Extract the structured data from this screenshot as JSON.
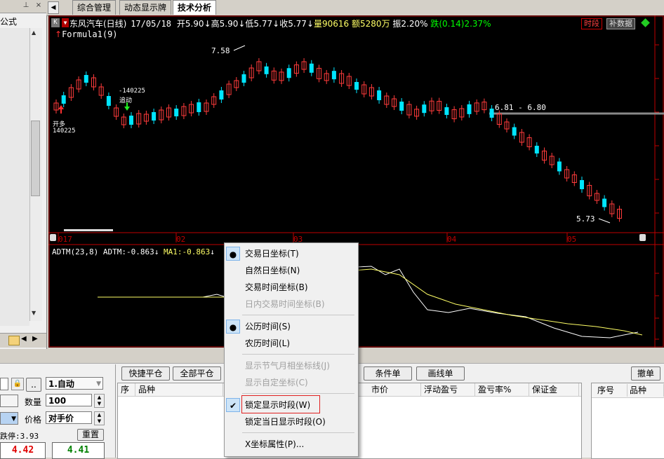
{
  "left_panel": {
    "title_label": "公式",
    "pin_glyph": "⊥",
    "close_glyph": "×"
  },
  "tabs": {
    "nav_arrow": "◀",
    "items": [
      {
        "label": "综合管理"
      },
      {
        "label": "动态显示牌"
      },
      {
        "label": "技术分析"
      }
    ]
  },
  "chart": {
    "header": {
      "k_badge": "K",
      "stock": "东风汽车(日线)",
      "date": "17/05/18",
      "open": "开5.90",
      "high": "高5.90",
      "low": "低5.77",
      "close": "收5.77",
      "volume": "量90616",
      "amount": "额5280万",
      "amplitude": "振2.20%",
      "change": "跌(0.14)2.37%",
      "formula": "Formula1(9)",
      "btn_period": "时段",
      "btn_fill": "补数据"
    },
    "annotations": {
      "high_label": "7.58",
      "low_label": "5.73",
      "range_line": "6.81 - 6.80",
      "buy_label": "开多",
      "buy_date": "140225",
      "chase_code": "-140225",
      "chase_label": "追动"
    },
    "x_axis": [
      "017",
      "02",
      "03",
      "04",
      "05"
    ],
    "indicator": {
      "name": "ADTM(23,8)",
      "adtm": "ADTM:-0.863",
      "ma1": "MA1:-0.863"
    },
    "colors": {
      "up": "#ff3b3b",
      "down": "#00e5ff",
      "axis": "#c00000",
      "ma": "#ffff66"
    }
  },
  "context_menu": {
    "items": [
      {
        "label": "交易日坐标(T)",
        "mark": "●",
        "boxed": true,
        "disabled": false
      },
      {
        "label": "自然日坐标(N)",
        "mark": "",
        "boxed": false,
        "disabled": false
      },
      {
        "label": "交易时间坐标(B)",
        "mark": "",
        "boxed": false,
        "disabled": false
      },
      {
        "label": "日内交易时间坐标(B)",
        "mark": "",
        "boxed": false,
        "disabled": true
      },
      {
        "label": "公历时间(S)",
        "mark": "●",
        "boxed": true,
        "disabled": false
      },
      {
        "label": "农历时间(L)",
        "mark": "",
        "boxed": false,
        "disabled": false
      },
      {
        "label": "显示节气月相坐标线(J)",
        "mark": "",
        "boxed": false,
        "disabled": true
      },
      {
        "label": "显示自定坐标(C)",
        "mark": "",
        "boxed": false,
        "disabled": true
      },
      {
        "label": "锁定显示时段(W)",
        "mark": "✔",
        "boxed": true,
        "disabled": false,
        "highlighted": true
      },
      {
        "label": "锁定当日显示时段(O)",
        "mark": "",
        "boxed": false,
        "disabled": false
      },
      {
        "label": "X坐标属性(P)...",
        "mark": "",
        "boxed": false,
        "disabled": false
      }
    ]
  },
  "trade_panel": {
    "mode_value": "1.自动",
    "qty_label": "数量",
    "qty_value": "100",
    "price_label": "价格",
    "price_value": "对手价",
    "limit_down": "跌停:3.93",
    "reset_button": "重置",
    "sell_price": "4.42",
    "buy_price": "4.41",
    "dots_button": "..",
    "lock_icon": "🔒"
  },
  "toolbar": {
    "quick_close": "快捷平仓",
    "close_all": "全部平仓",
    "condition": "条件单",
    "draw_line": "画线单",
    "cancel": "撤单"
  },
  "positions_table": {
    "headers": [
      "序",
      "品种",
      "市价",
      "浮动盈亏",
      "盈亏率%",
      "保证金"
    ]
  },
  "orders_table": {
    "headers": [
      "序号",
      "品种"
    ]
  }
}
